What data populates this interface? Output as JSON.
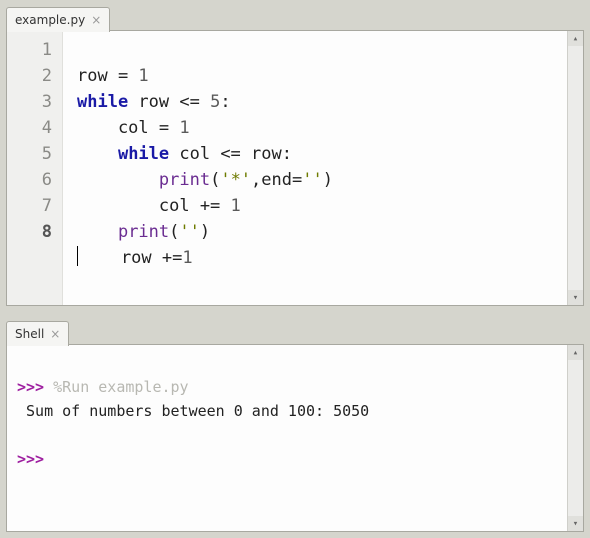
{
  "editor": {
    "tab_label": "example.py",
    "lines": {
      "l1": "1",
      "l2": "2",
      "l3": "3",
      "l4": "4",
      "l5": "5",
      "l6": "6",
      "l7": "7",
      "l8": "8"
    },
    "code": {
      "row_eq": "row = ",
      "one_a": "1",
      "while1": "while",
      "cond1": " row <= ",
      "five": "5",
      "colon1": ":",
      "col_eq": "    col = ",
      "one_b": "1",
      "while2": "while",
      "cond2": " col <= row:",
      "indent2": "    ",
      "print1": "print",
      "args1": "(",
      "star": "'*'",
      "comma": ",end=",
      "empty1": "''",
      "close1": ")",
      "indent3": "        ",
      "colpluseq": "        col += ",
      "one_c": "1",
      "print2": "print",
      "args2": "(",
      "empty2": "''",
      "close2": ")",
      "indent1b": "    ",
      "rowpluseq": "    row +=",
      "one_d": "1"
    }
  },
  "shell": {
    "tab_label": "Shell",
    "prompt": ">>>",
    "run_cmd": "%Run example.py",
    "output": " Sum of numbers between 0 and 100: 5050"
  }
}
